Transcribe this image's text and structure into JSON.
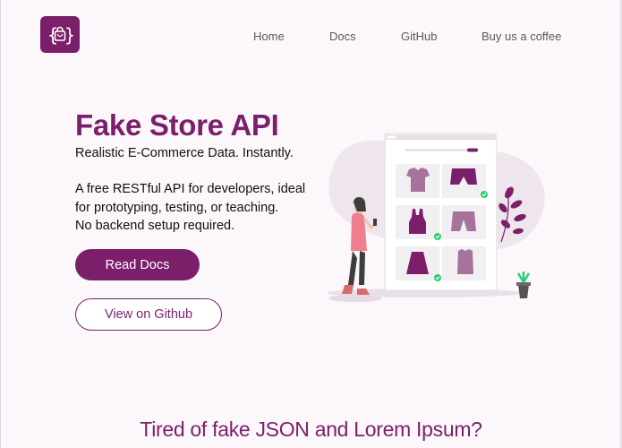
{
  "nav": {
    "items": [
      "Home",
      "Docs",
      "GitHub",
      "Buy us a coffee"
    ]
  },
  "hero": {
    "title": "Fake Store API",
    "tagline": "Realistic E-Commerce Data. Instantly.",
    "description_lines": [
      "A free RESTful API for developers, ideal",
      "for prototyping, testing, or teaching.",
      "No backend setup required."
    ],
    "primary_button": "Read Docs",
    "secondary_button": "View on Github"
  },
  "section": {
    "title": "Tired of fake JSON and Lorem Ipsum?"
  },
  "colors": {
    "brand": "#7b1f6a",
    "background": "#fbf7fb",
    "check": "#2ecc71"
  },
  "icons": {
    "logo": "shopping-bag-icon"
  }
}
